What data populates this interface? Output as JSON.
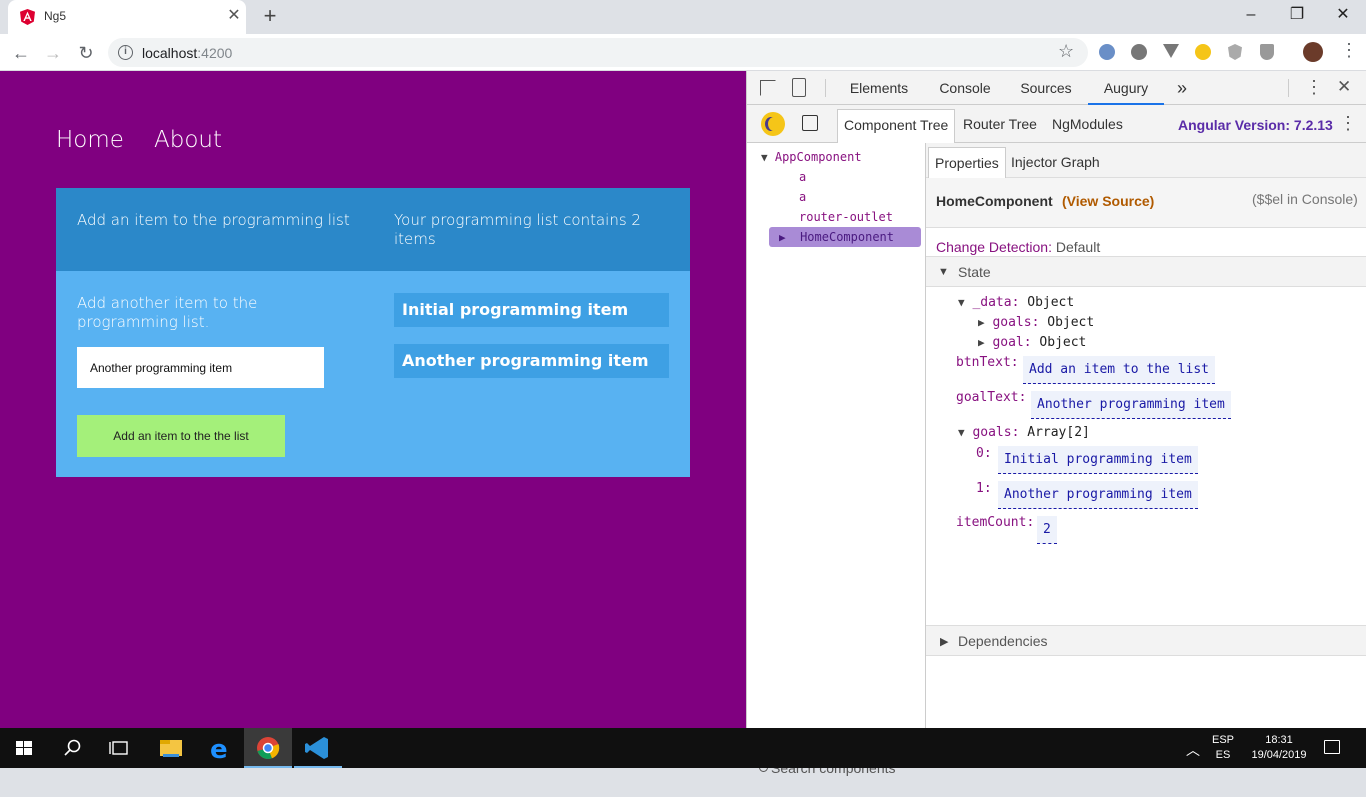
{
  "browser": {
    "tab_title": "Ng5",
    "tab_close": "✕",
    "new_tab": "+",
    "url": "localhost",
    "url_port": ":4200",
    "window": {
      "minimize": "–",
      "maximize": "❐",
      "close": "✕"
    }
  },
  "app": {
    "nav": {
      "home": "Home",
      "about": "About"
    },
    "header_left": "Add an item to the programming list",
    "header_right": "Your programming list contains 2 items",
    "prompt": "Add another item to the programming list.",
    "input_value": "Another programming item",
    "button_label": "Add an item to the the list",
    "items": [
      "Initial programming item",
      "Another programming item"
    ],
    "colors": {
      "page_bg": "#800080",
      "card_bg": "#58b2f2",
      "card_header": "#2b88c9",
      "item_bg": "#3ea0e4",
      "button_bg": "#a4f07a"
    }
  },
  "devtools": {
    "tabs": [
      "Elements",
      "Console",
      "Sources",
      "Augury"
    ],
    "more": "»",
    "active_tab": "Augury",
    "augury_tabs": [
      "Component Tree",
      "Router Tree",
      "NgModules"
    ],
    "angular_version": "Angular Version: 7.2.13",
    "tree": {
      "root": "AppComponent",
      "children": [
        "a",
        "a",
        "router-outlet"
      ],
      "selected": "HomeComponent"
    },
    "search_placeholder": "Search components",
    "props_tabs": [
      "Properties",
      "Injector Graph"
    ],
    "component_name": "HomeComponent",
    "view_source": "(View Source)",
    "console_hint": "($$el in Console)",
    "change_detection_label": "Change Detection:",
    "change_detection_value": "Default",
    "state_label": "State",
    "state": {
      "data_key": "_data:",
      "data_type": "Object",
      "goals_key": "goals:",
      "goals_type": "Object",
      "goal_key": "goal:",
      "goal_type": "Object",
      "btnText_key": "btnText:",
      "btnText_val": "Add an item to the list",
      "goalText_key": "goalText:",
      "goalText_val": "Another programming item",
      "goals_arr_key": "goals:",
      "goals_arr_type": "Array[2]",
      "idx0": "0:",
      "idx0_val": "Initial programming item",
      "idx1": "1:",
      "idx1_val": "Another programming item",
      "itemCount_key": "itemCount:",
      "itemCount_val": "2"
    },
    "dependencies_label": "Dependencies"
  },
  "taskbar": {
    "lang_top": "ESP",
    "lang_bottom": "ES",
    "time": "18:31",
    "date": "19/04/2019"
  }
}
